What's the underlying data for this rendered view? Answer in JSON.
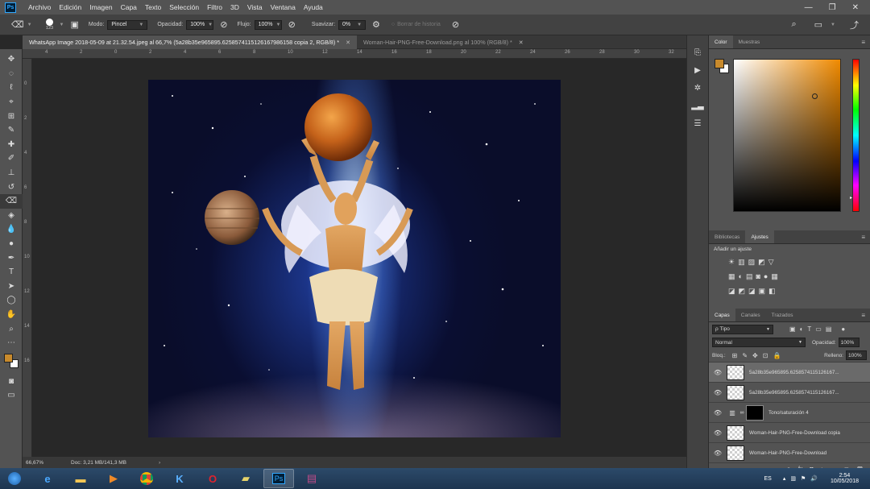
{
  "app": {
    "logo": "Ps"
  },
  "menubar": {
    "items": [
      "Archivo",
      "Edición",
      "Imagen",
      "Capa",
      "Texto",
      "Selección",
      "Filtro",
      "3D",
      "Vista",
      "Ventana",
      "Ayuda"
    ],
    "window_controls": [
      "—",
      "❐",
      "✕"
    ]
  },
  "options": {
    "brush_size": "123",
    "mode_label": "Modo:",
    "mode_value": "Pincel",
    "opacity_label": "Opacidad:",
    "opacity_value": "100%",
    "flow_label": "Flujo:",
    "flow_value": "100%",
    "smooth_label": "Suavizar:",
    "smooth_value": "0%",
    "erase_history_label": "Borrar de historia"
  },
  "tabs": [
    {
      "label": "WhatsApp Image 2018-05-09 at 21.32.54.jpeg al 66,7% (5a28b35e965895.6258574115126167986158 copia 2, RGB/8) *",
      "active": true
    },
    {
      "label": "Woman-Hair-PNG-Free-Download.png al 100% (RGB/8) *",
      "active": false
    }
  ],
  "ruler_h_ticks": [
    "4",
    "2",
    "0",
    "2",
    "4",
    "6",
    "8",
    "10",
    "12",
    "14",
    "16",
    "18",
    "20",
    "22",
    "24",
    "26",
    "28",
    "30",
    "32"
  ],
  "ruler_v_ticks": [
    "0",
    "2",
    "4",
    "6",
    "8",
    "10",
    "12",
    "14",
    "16"
  ],
  "status": {
    "zoom": "66,67%",
    "doc": "Doc: 3,21 MB/141,3 MB"
  },
  "color_panel": {
    "tabs": [
      "Color",
      "Muestras"
    ],
    "foreground": "#c88a2c",
    "background": "#ffffff",
    "hue_color": "#f08a00"
  },
  "adjust_panel": {
    "tabs": [
      "Bibliotecas",
      "Ajustes"
    ],
    "title": "Añadir un ajuste",
    "row1": [
      "☀",
      "▥",
      "▨",
      "◩",
      "▽"
    ],
    "row2": [
      "▦",
      "◐",
      "▤",
      "◙",
      "●",
      "▦"
    ],
    "row3": [
      "◪",
      "◩",
      "◪",
      "▣",
      "◧"
    ]
  },
  "layers_panel": {
    "tabs": [
      "Capas",
      "Canales",
      "Trazados"
    ],
    "filter_label": "ρ Tipo",
    "blend_mode": "Normal",
    "opacity_label": "Opacidad:",
    "opacity_value": "100%",
    "lock_label": "Bloq.:",
    "fill_label": "Relleno:",
    "fill_value": "100%",
    "layers": [
      {
        "name": "5a28b35e965895.6258574115126167...",
        "selected": true
      },
      {
        "name": "5a28b35e965895.6258574115126167...",
        "selected": false
      },
      {
        "name": "Tono/saturación 4",
        "selected": false
      },
      {
        "name": "Woman-Hair-PNG-Free-Download copia",
        "selected": false
      },
      {
        "name": "Woman-Hair-PNG-Free-Download",
        "selected": false
      }
    ],
    "footer_icons": [
      "⊖",
      "fx",
      "◘",
      "◐",
      "▭",
      "▢",
      "🗑"
    ]
  },
  "taskbar": {
    "lang": "ES",
    "time": "2:54",
    "date": "10/05/2018"
  }
}
